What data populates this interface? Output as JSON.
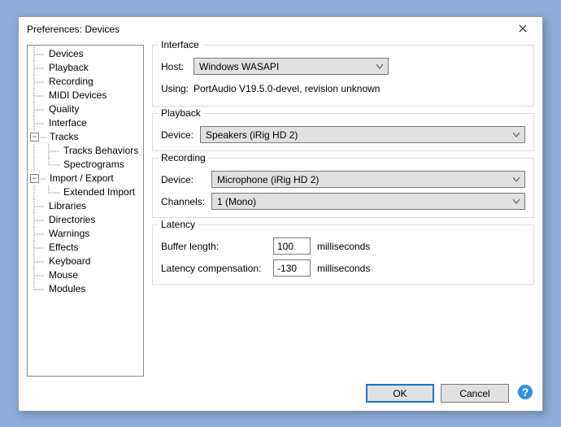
{
  "window": {
    "title": "Preferences: Devices"
  },
  "tree": {
    "devices": "Devices",
    "playback": "Playback",
    "recording": "Recording",
    "midi_devices": "MIDI Devices",
    "quality": "Quality",
    "interface": "Interface",
    "tracks": "Tracks",
    "tracks_behaviors": "Tracks Behaviors",
    "spectrograms": "Spectrograms",
    "import_export": "Import / Export",
    "extended_import": "Extended Import",
    "libraries": "Libraries",
    "directories": "Directories",
    "warnings": "Warnings",
    "effects": "Effects",
    "keyboard": "Keyboard",
    "mouse": "Mouse",
    "modules": "Modules"
  },
  "interface_group": {
    "title": "Interface",
    "host_label": "Host:",
    "host_value": "Windows WASAPI",
    "using_label": "Using:",
    "using_value": "PortAudio V19.5.0-devel, revision unknown"
  },
  "playback_group": {
    "title": "Playback",
    "device_label": "Device:",
    "device_value": "Speakers (iRig HD 2)"
  },
  "recording_group": {
    "title": "Recording",
    "device_label": "Device:",
    "device_value": "Microphone (iRig HD 2)",
    "channels_label": "Channels:",
    "channels_value": "1 (Mono)"
  },
  "latency_group": {
    "title": "Latency",
    "buffer_label": "Buffer length:",
    "buffer_value": "100",
    "buffer_unit": "milliseconds",
    "comp_label": "Latency compensation:",
    "comp_value": "-130",
    "comp_unit": "milliseconds"
  },
  "footer": {
    "ok": "OK",
    "cancel": "Cancel"
  },
  "glyphs": {
    "minus": "−"
  }
}
